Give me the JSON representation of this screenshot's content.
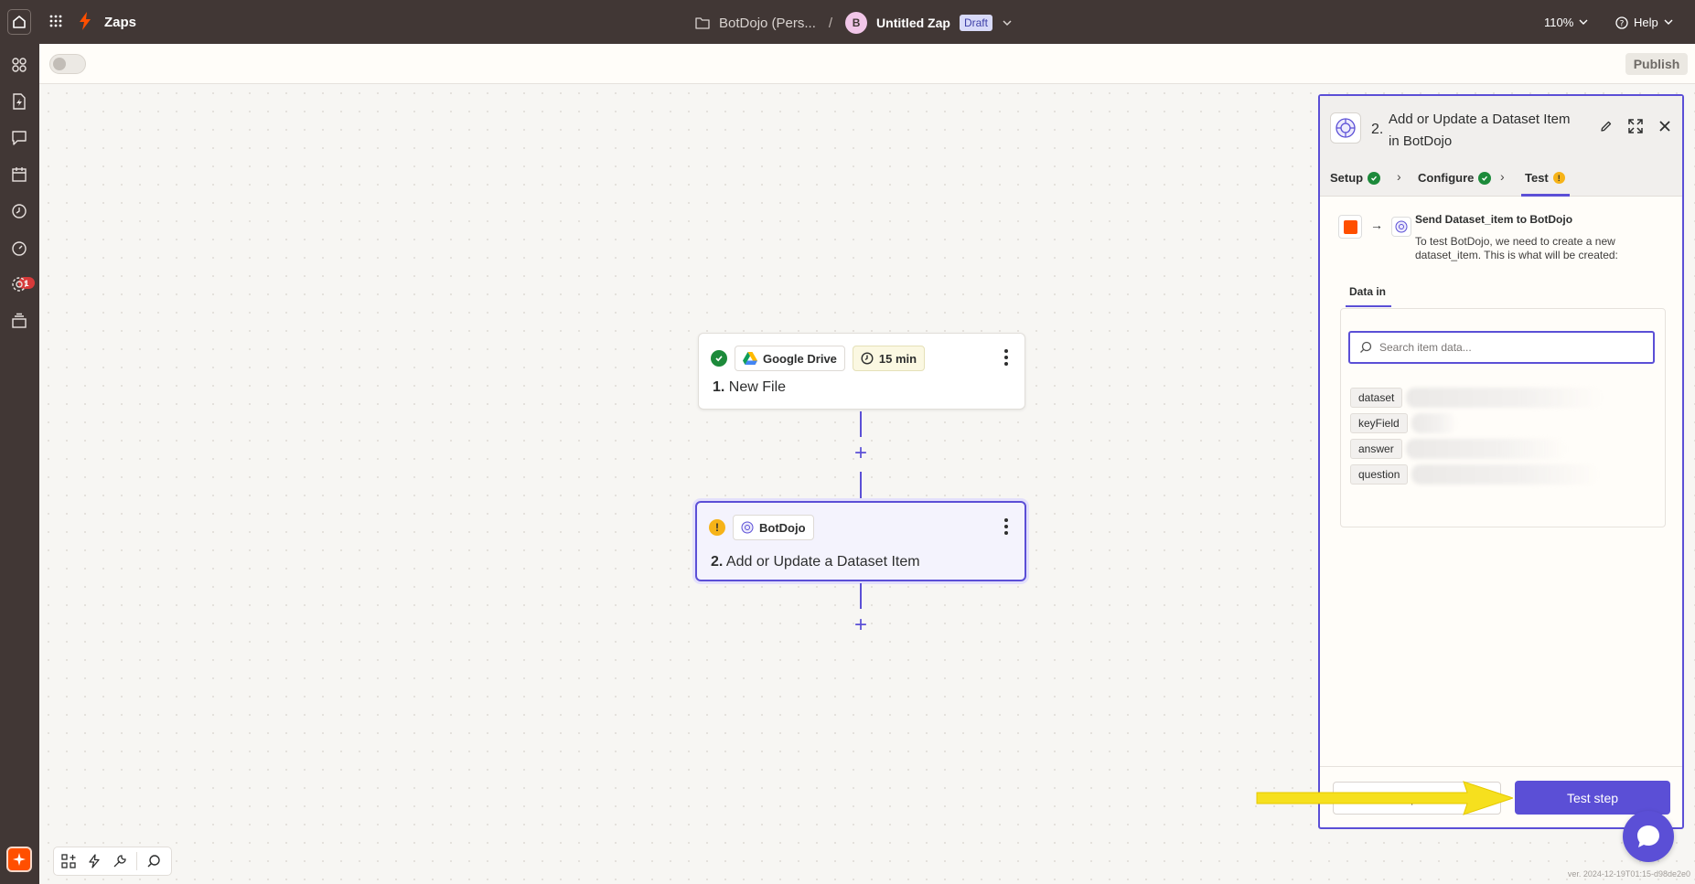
{
  "topbar": {
    "app_title": "Zaps",
    "folder_name": "BotDojo (Pers...",
    "breadcrumb_separator": "/",
    "avatar_letter": "B",
    "zap_name": "Untitled Zap",
    "status_badge": "Draft",
    "zoom_level": "110%",
    "help_label": "Help"
  },
  "rail": {
    "notification_count": "1"
  },
  "subbar": {
    "publish_label": "Publish"
  },
  "canvas": {
    "step1": {
      "app_name": "Google Drive",
      "poll_interval": "15 min",
      "number": "1.",
      "title": "New File"
    },
    "step2": {
      "app_name": "BotDojo",
      "number": "2.",
      "title": "Add or Update a Dataset Item"
    }
  },
  "panel": {
    "step_number": "2.",
    "title": "Add or Update a Dataset Item in BotDojo",
    "tabs": [
      {
        "label": "Setup"
      },
      {
        "label": "Configure"
      },
      {
        "label": "Test"
      }
    ],
    "send_title": "Send Dataset_item to BotDojo",
    "send_description": "To test BotDojo, we need to create a new dataset_item. This is what will be created:",
    "data_in_tab": "Data in",
    "search_placeholder": "Search item data...",
    "fields": [
      {
        "key": "dataset"
      },
      {
        "key": "keyField"
      },
      {
        "key": "answer"
      },
      {
        "key": "question"
      }
    ],
    "skip_label": "Skip test",
    "test_label": "Test step"
  },
  "footer": {
    "version": "ver. 2024-12-19T01:15-d98de2e0"
  },
  "colors": {
    "accent": "#5b4fd6",
    "brand_orange": "#ff4f00",
    "topbar_bg": "#413735",
    "success": "#1c8a3a",
    "warning": "#f6b318",
    "annotation_arrow": "#f6e01e"
  }
}
